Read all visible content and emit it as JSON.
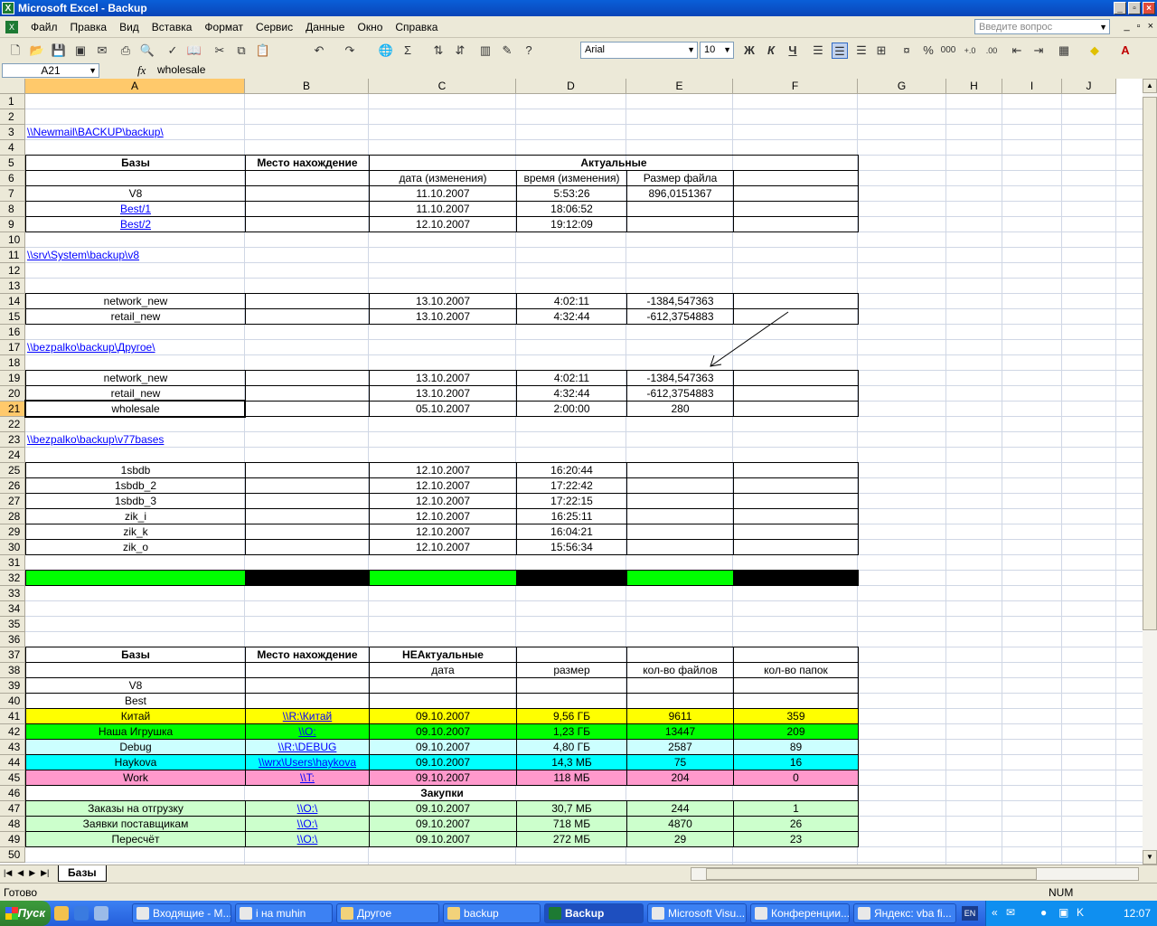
{
  "window": {
    "title": "Microsoft Excel - Backup"
  },
  "menu": [
    "Файл",
    "Правка",
    "Вид",
    "Вставка",
    "Формат",
    "Сервис",
    "Данные",
    "Окно",
    "Справка"
  ],
  "ask_placeholder": "Введите вопрос",
  "toolbar": {
    "font": "Arial",
    "size": "10"
  },
  "namebox": "A21",
  "formula": "wholesale",
  "columns": [
    "A",
    "B",
    "C",
    "D",
    "E",
    "F",
    "G",
    "H",
    "I",
    "J"
  ],
  "rows": {
    "r3": "\\\\Newmail\\BACKUP\\backup\\",
    "r5": {
      "a": "Базы",
      "b": "Место нахождение",
      "c": "Актуальные"
    },
    "r6": {
      "c": "дата (изменения)",
      "d": "время (изменения)",
      "e": "Размер файла"
    },
    "r7": {
      "a": "V8",
      "c": "11.10.2007",
      "d": "5:53:26",
      "e": "896,0151367"
    },
    "r8": {
      "a": "Best/1",
      "c": "11.10.2007",
      "d": "18:06:52"
    },
    "r9": {
      "a": "Best/2",
      "c": "12.10.2007",
      "d": "19:12:09"
    },
    "r11": "\\\\srv\\System\\backup\\v8",
    "r14": {
      "a": "network_new",
      "c": "13.10.2007",
      "d": "4:02:11",
      "e": "-1384,547363"
    },
    "r15": {
      "a": "retail_new",
      "c": "13.10.2007",
      "d": "4:32:44",
      "e": "-612,3754883"
    },
    "r17": "\\\\bezpalko\\backup\\Другое\\",
    "r19": {
      "a": "network_new",
      "c": "13.10.2007",
      "d": "4:02:11",
      "e": "-1384,547363"
    },
    "r20": {
      "a": "retail_new",
      "c": "13.10.2007",
      "d": "4:32:44",
      "e": "-612,3754883"
    },
    "r21": {
      "a": "wholesale",
      "c": "05.10.2007",
      "d": "2:00:00",
      "e": "280"
    },
    "r23": "\\\\bezpalko\\backup\\v77bases",
    "r25": {
      "a": "1sbdb",
      "c": "12.10.2007",
      "d": "16:20:44"
    },
    "r26": {
      "a": "1sbdb_2",
      "c": "12.10.2007",
      "d": "17:22:42"
    },
    "r27": {
      "a": "1sbdb_3",
      "c": "12.10.2007",
      "d": "17:22:15"
    },
    "r28": {
      "a": "zik_i",
      "c": "12.10.2007",
      "d": "16:25:11"
    },
    "r29": {
      "a": "zik_k",
      "c": "12.10.2007",
      "d": "16:04:21"
    },
    "r30": {
      "a": "zik_o",
      "c": "12.10.2007",
      "d": "15:56:34"
    },
    "r37": {
      "a": "Базы",
      "b": "Место нахождение",
      "c": "НЕАктуальные"
    },
    "r38": {
      "c": "дата",
      "d": "размер",
      "e": "кол-во файлов",
      "f": "кол-во папок"
    },
    "r39": {
      "a": "V8"
    },
    "r40": {
      "a": "Best"
    },
    "r41": {
      "a": "Китай",
      "b": "\\\\R:\\Китай",
      "c": "09.10.2007",
      "d": "9,56 ГБ",
      "e": "9611",
      "f": "359"
    },
    "r42": {
      "a": "Наша Игрушка",
      "b": "\\\\O:",
      "c": "09.10.2007",
      "d": "1,23 ГБ",
      "e": "13447",
      "f": "209"
    },
    "r43": {
      "a": "Debug",
      "b": "\\\\R:\\DEBUG",
      "c": "09.10.2007",
      "d": "4,80 ГБ",
      "e": "2587",
      "f": "89"
    },
    "r44": {
      "a": "Haykova",
      "b": "\\\\wrx\\Users\\haykova",
      "c": "09.10.2007",
      "d": "14,3 МБ",
      "e": "75",
      "f": "16"
    },
    "r45": {
      "a": "Work",
      "b": "\\\\T:",
      "c": "09.10.2007",
      "d": "118 МБ",
      "e": "204",
      "f": "0"
    },
    "r46": {
      "c": "Закупки"
    },
    "r47": {
      "a": "Заказы на отгрузку",
      "b": "\\\\O:\\",
      "c": "09.10.2007",
      "d": "30,7 МБ",
      "e": "244",
      "f": "1"
    },
    "r48": {
      "a": "Заявки поставщикам",
      "b": "\\\\O:\\",
      "c": "09.10.2007",
      "d": "718 МБ",
      "e": "4870",
      "f": "26"
    },
    "r49": {
      "a": "Пересчёт",
      "b": "\\\\O:\\",
      "c": "09.10.2007",
      "d": "272 МБ",
      "e": "29",
      "f": "23"
    }
  },
  "sheet_tab": "Базы",
  "status": {
    "ready": "Готово",
    "num": "NUM"
  },
  "taskbar": {
    "start": "Пуск",
    "tasks": [
      "Входящие - М...",
      "i на muhin",
      "Другое",
      "backup",
      "Backup",
      "Microsoft Visu...",
      "Конференции...",
      "Яндекс: vba fi..."
    ],
    "lang": "EN",
    "clock": "12:07"
  },
  "colors": {
    "yellow": "#ffff00",
    "green": "#00ff00",
    "cyan": "#ccffff",
    "cyan2": "#00ffff",
    "pink": "#ff99cc",
    "lightgreen": "#ccffcc",
    "black": "#000000"
  }
}
